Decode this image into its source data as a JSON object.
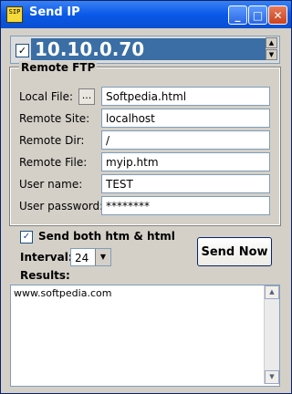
{
  "window": {
    "title": "Send IP",
    "icon_label": "SIP",
    "controls": [
      "minimize",
      "maximize",
      "close"
    ]
  },
  "ip": {
    "checked": true,
    "value": "10.10.0.70"
  },
  "remote_ftp": {
    "title": "Remote FTP",
    "browse_label": "...",
    "fields": [
      {
        "label": "Local File:",
        "value": "Softpedia.html"
      },
      {
        "label": "Remote Site:",
        "value": "localhost"
      },
      {
        "label": "Remote Dir:",
        "value": "/"
      },
      {
        "label": "Remote File:",
        "value": "myip.htm"
      },
      {
        "label": "User name:",
        "value": "TEST"
      },
      {
        "label": "User password:",
        "value": "********"
      }
    ]
  },
  "options": {
    "send_both_label": "Send both htm & html",
    "send_both_checked": true,
    "interval_label": "Interval:",
    "interval_value": "24"
  },
  "actions": {
    "send_now_label": "Send Now"
  },
  "results": {
    "label": "Results:",
    "text": "www.softpedia.com"
  },
  "colors": {
    "titlebar": "#0a59e8",
    "ip_field": "#3a6ea5",
    "window_bg": "#d4d0c8"
  }
}
